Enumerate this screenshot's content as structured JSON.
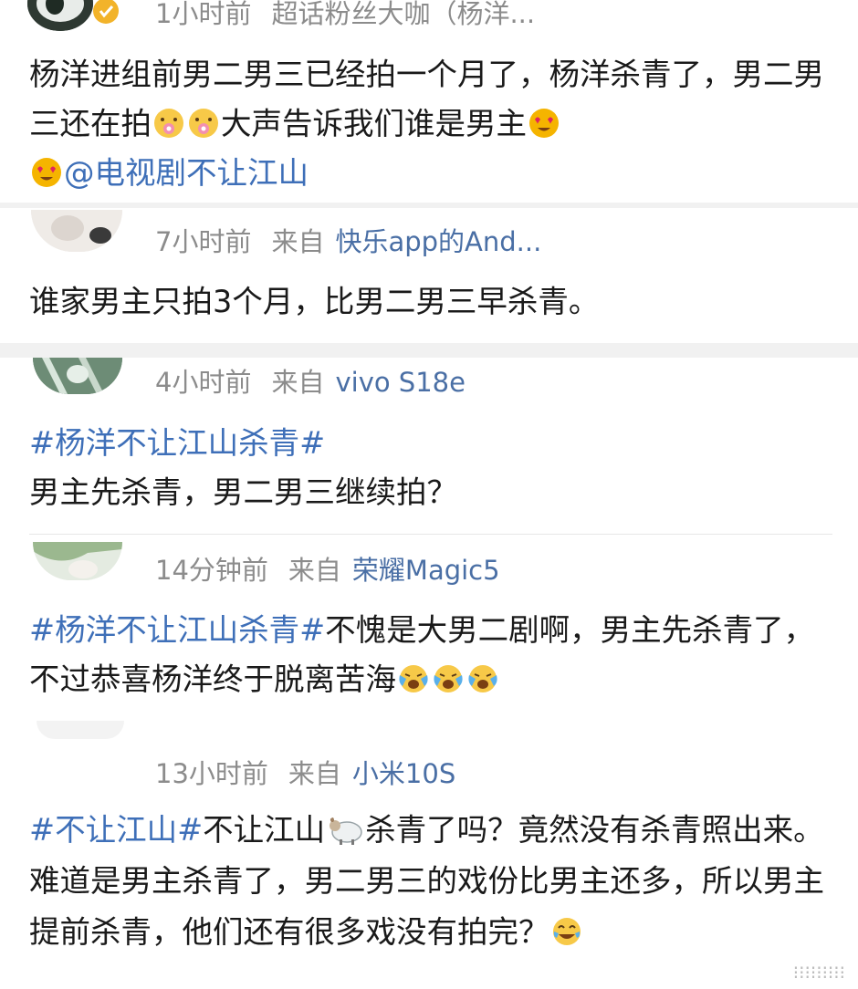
{
  "comments": [
    {
      "time": "1小时前",
      "source_label": "",
      "device": "超话粉丝大咖（杨洋...",
      "text": {
        "part1": "杨洋进组前男二男三已经拍一个月了，杨洋杀青了，男二男三还在拍",
        "part2": "大声告诉我们谁是男主",
        "mention": "@电视剧不让江山"
      }
    },
    {
      "time": "7小时前",
      "source_label": "来自",
      "device": "快乐app的And...",
      "text": {
        "plain": "谁家男主只拍3个月，比男二男三早杀青。"
      }
    },
    {
      "time": "4小时前",
      "source_label": "来自",
      "device": "vivo S18e",
      "text": {
        "topic": "#杨洋不让江山杀青#",
        "plain": "男主先杀青，男二男三继续拍？"
      }
    },
    {
      "time": "14分钟前",
      "source_label": "来自",
      "device": "荣耀Magic5",
      "text": {
        "topic": "#杨洋不让江山杀青#",
        "plain": "不愧是大男二剧啊，男主先杀青了，不过恭喜杨洋终于脱离苦海"
      }
    },
    {
      "time": "13小时前",
      "source_label": "来自",
      "device": "小米10S",
      "text": {
        "topic": "#不让江山#",
        "part1": "不让江山",
        "part2": "杀青了吗？竟然没有杀青照出来。难道是男主杀青了，男二男三的戏份比男主还多，所以男主提前杀青，他们还有很多戏没有拍完？"
      }
    }
  ],
  "colors": {
    "link": "#3e6fb8",
    "meta": "#8c8c8c",
    "text": "#1a1a1a",
    "band": "#f1f1f1"
  },
  "icons": [
    "verified-badge-icon",
    "heart-eyes-emoji-icon",
    "blushing-flower-emoji-icon",
    "crying-laughing-emoji-icon",
    "sheep-emoji-icon",
    "tears-of-joy-emoji-icon"
  ]
}
